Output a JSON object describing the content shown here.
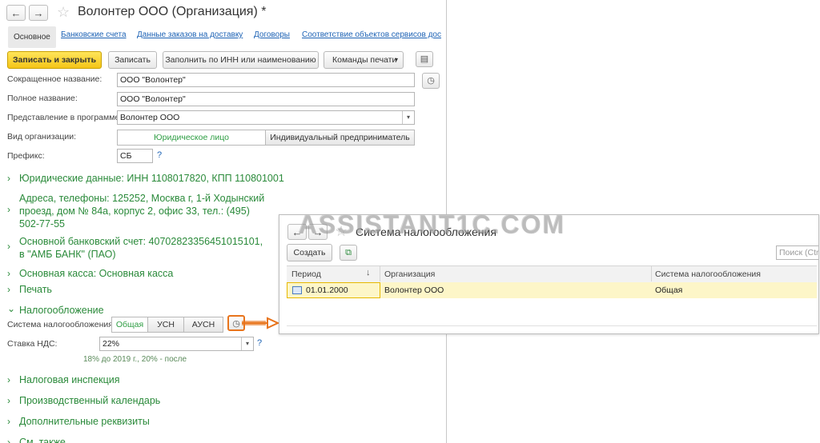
{
  "window": {
    "title": "Волонтер ООО (Организация) *"
  },
  "tabs": [
    "Основное",
    "Банковские счета",
    "Данные заказов на доставку",
    "Договоры",
    "Соответствие объектов сервисов дос"
  ],
  "toolbar": {
    "save_close": "Записать и закрыть",
    "save": "Записать",
    "fill_inn": "Заполнить по ИНН или наименованию",
    "print_commands": "Команды печати"
  },
  "form": {
    "short_name_label": "Сокращенное название:",
    "short_name_value": "ООО \"Волонтер\"",
    "full_name_label": "Полное название:",
    "full_name_value": "ООО \"Волонтер\"",
    "display_label": "Представление в программе:",
    "display_value": "Волонтер ООО",
    "org_type_label": "Вид организации:",
    "org_type_options": [
      "Юридическое лицо",
      "Индивидуальный предприниматель"
    ],
    "prefix_label": "Префикс:",
    "prefix_value": "СБ",
    "help_mark": "?"
  },
  "groups": {
    "legal": "Юридические данные: ИНН 1108017820, КПП 110801001",
    "address_lines": [
      "Адреса, телефоны: 125252, Москва г, 1-й Ходынский",
      "проезд, дом № 84а, корпус 2, офис 33, тел.: (495)",
      "502-77-55"
    ],
    "bank_lines": [
      "Основной банковский счет: 40702823356451015101,",
      "в \"АМБ БАНК\" (ПАО)"
    ],
    "cash": "Основная касса: Основная касса",
    "print": "Печать",
    "taxation": "Налогообложение",
    "tax_office": "Налоговая инспекция",
    "calendar": "Производственный календарь",
    "additional": "Дополнительные реквизиты",
    "see_also": "См. также"
  },
  "taxation": {
    "system_label": "Система налогообложения:",
    "options": [
      "Общая",
      "УСН",
      "АУСН"
    ],
    "vat_label": "Ставка НДС:",
    "vat_value": "22%",
    "vat_hint": "18% до 2019 г., 20% - после"
  },
  "popup": {
    "title": "Система налогообложения",
    "create": "Создать",
    "search_placeholder": "Поиск (Ctrl",
    "columns": [
      "Период",
      "Организация",
      "Система налогообложения"
    ],
    "rows": [
      {
        "period": "01.01.2000",
        "org": "Волонтер ООО",
        "system": "Общая"
      }
    ]
  },
  "watermark": "ASSISTANT1C.COM",
  "colors": {
    "accent_green": "#2a8a3a",
    "link_blue": "#1e63b5",
    "primary_yellow": "#f5c518",
    "callout_orange": "#e8741c",
    "row_highlight": "#fdf6c8"
  }
}
